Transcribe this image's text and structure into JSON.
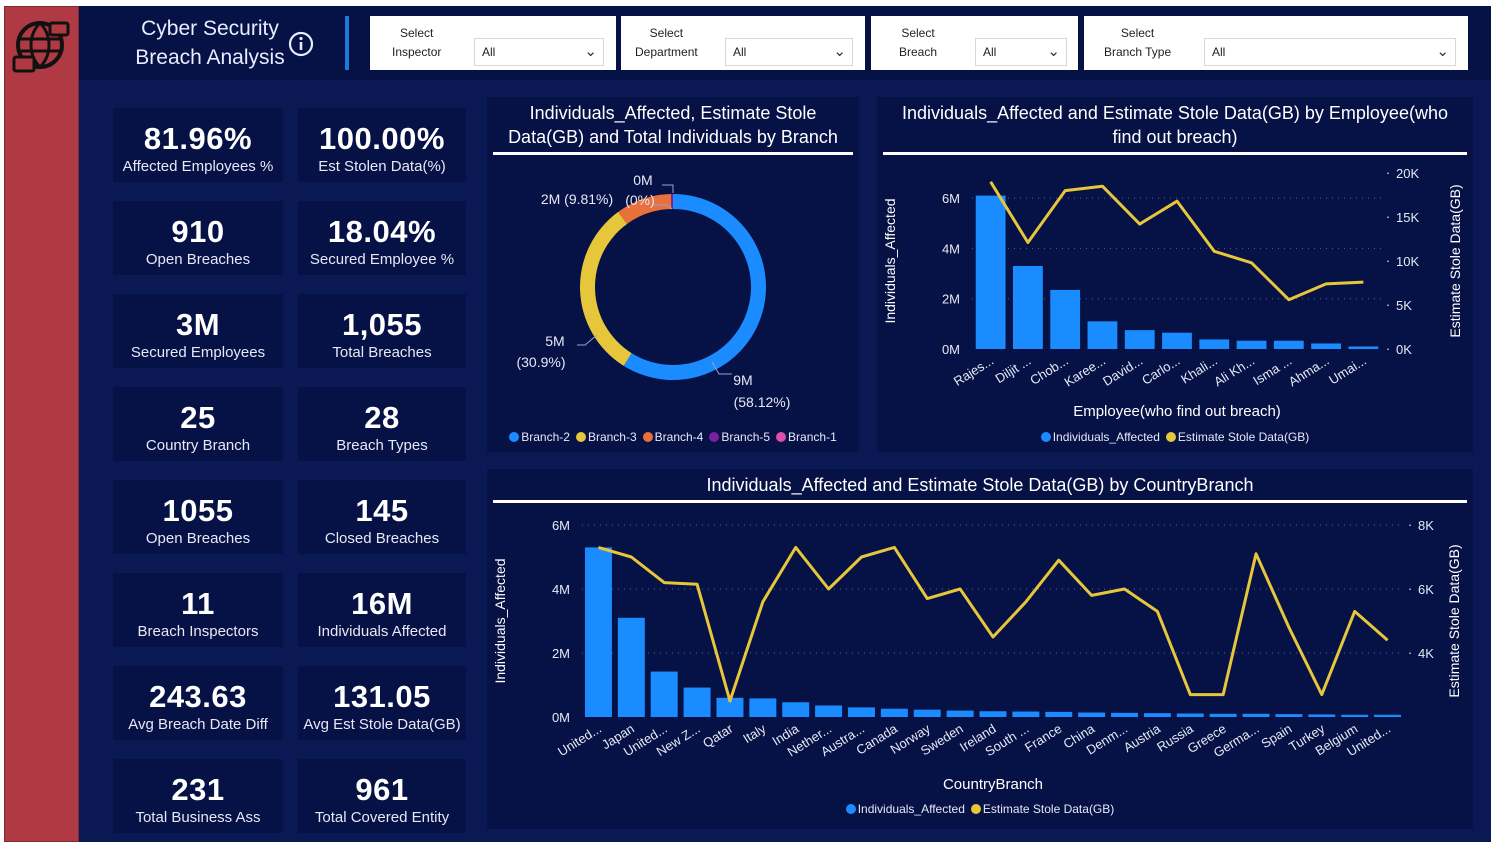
{
  "header": {
    "title_line1": "Cyber Security",
    "title_line2": "Breach Analysis",
    "filters": [
      {
        "label1": "Select",
        "label2": "Inspector",
        "value": "All"
      },
      {
        "label1": "Select",
        "label2": "Department",
        "value": "All"
      },
      {
        "label1": "Select",
        "label2": "Breach",
        "value": "All"
      },
      {
        "label1": "Select",
        "label2": "Branch Type",
        "value": "All"
      }
    ]
  },
  "kpis": [
    {
      "value": "81.96%",
      "label": "Affected Employees %"
    },
    {
      "value": "100.00%",
      "label": "Est Stolen Data(%)"
    },
    {
      "value": "910",
      "label": "Open Breaches"
    },
    {
      "value": "18.04%",
      "label": "Secured Employee %"
    },
    {
      "value": "3M",
      "label": "Secured Employees"
    },
    {
      "value": "1,055",
      "label": "Total Breaches"
    },
    {
      "value": "25",
      "label": "Country Branch"
    },
    {
      "value": "28",
      "label": "Breach Types"
    },
    {
      "value": "1055",
      "label": "Open Breaches"
    },
    {
      "value": "145",
      "label": "Closed Breaches"
    },
    {
      "value": "11",
      "label": "Breach Inspectors"
    },
    {
      "value": "16M",
      "label": "Individuals Affected"
    },
    {
      "value": "243.63",
      "label": "Avg Breach Date Diff"
    },
    {
      "value": "131.05",
      "label": "Avg Est Stole Data(GB)"
    },
    {
      "value": "231",
      "label": "Total Business Ass"
    },
    {
      "value": "961",
      "label": "Total Covered Entity"
    }
  ],
  "colors": {
    "sidebar": "#b03a43",
    "background": "#0a1854",
    "panel": "#061145",
    "bar": "#1a8cff",
    "line": "#e6c63a",
    "branch2": "#1a8cff",
    "branch3": "#e6c63a",
    "branch4": "#e8703a",
    "branch5": "#7a1fa0",
    "branch1": "#e04fa8"
  },
  "icons": {
    "logo": "globe-network-icon",
    "info": "info-icon",
    "dropdown": "chevron-down-icon"
  },
  "chart_data": [
    {
      "type": "pie",
      "donut": true,
      "title": "Individuals_Affected, Estimate Stole Data(GB) and Total Individuals by Branch",
      "categories": [
        "Branch-2",
        "Branch-3",
        "Branch-4",
        "Branch-5",
        "Branch-1"
      ],
      "values": [
        9.1,
        4.8,
        1.5,
        0.05,
        0.0
      ],
      "data_labels": [
        "9M\n(58.12%)",
        "5M\n(30.9%)",
        "2M (9.81%)",
        "0M\n(0%)",
        ""
      ],
      "legend": "bottom"
    },
    {
      "type": "bar",
      "combo_line": true,
      "title": "Individuals_Affected and Estimate Stole Data(GB) by Employee(who find out breach)",
      "xlabel": "Employee(who find out breach)",
      "ylabel": "Individuals_Affected",
      "y2label": "Estimate Stole Data(GB)",
      "categories": [
        "Rajes...",
        "Diljit ...",
        "Chob...",
        "Karee...",
        "David...",
        "Carlo...",
        "Khali...",
        "Ali Kh...",
        "Isma ...",
        "Ahma...",
        "Umai..."
      ],
      "yticks": [
        "0M",
        "2M",
        "4M",
        "6M"
      ],
      "y2ticks": [
        "0K",
        "5K",
        "10K",
        "15K",
        "20K"
      ],
      "ylim": [
        0,
        7
      ],
      "y2lim": [
        0,
        20000
      ],
      "series": [
        {
          "name": "Individuals_Affected",
          "axis": "left",
          "values": [
            6.1,
            3.3,
            2.35,
            1.1,
            0.75,
            0.65,
            0.38,
            0.33,
            0.33,
            0.22,
            0.1
          ]
        },
        {
          "name": "Estimate Stole Data(GB)",
          "axis": "right",
          "values": [
            19000,
            12100,
            18000,
            18500,
            14200,
            16800,
            11100,
            9800,
            5600,
            7400,
            7600
          ]
        }
      ],
      "legend": "bottom"
    },
    {
      "type": "bar",
      "combo_line": true,
      "title": "Individuals_Affected and Estimate Stole Data(GB) by CountryBranch",
      "xlabel": "CountryBranch",
      "ylabel": "Individuals_Affected",
      "y2label": "Estimate Stole Data(GB)",
      "categories": [
        "United...",
        "Japan",
        "United...",
        "New Z...",
        "Qatar",
        "Italy",
        "India",
        "Nether...",
        "Austra...",
        "Canada",
        "Norway",
        "Sweden",
        "Ireland",
        "South ...",
        "France",
        "China",
        "Denm...",
        "Austria",
        "Russia",
        "Greece",
        "Germa...",
        "Spain",
        "Turkey",
        "Belgium",
        "United..."
      ],
      "yticks": [
        "0M",
        "2M",
        "4M",
        "6M"
      ],
      "y2ticks": [
        "4K",
        "6K",
        "8K"
      ],
      "ylim": [
        0,
        6
      ],
      "y2lim": [
        2000,
        8000
      ],
      "series": [
        {
          "name": "Individuals_Affected",
          "axis": "left",
          "values": [
            5.3,
            3.1,
            1.42,
            0.92,
            0.6,
            0.58,
            0.46,
            0.36,
            0.3,
            0.26,
            0.23,
            0.2,
            0.18,
            0.17,
            0.16,
            0.14,
            0.13,
            0.12,
            0.11,
            0.1,
            0.1,
            0.09,
            0.08,
            0.07,
            0.07
          ]
        },
        {
          "name": "Estimate Stole Data(GB)",
          "axis": "right",
          "values": [
            7300,
            7000,
            6200,
            6150,
            2500,
            5600,
            7300,
            6000,
            7000,
            7300,
            5700,
            6000,
            4500,
            5600,
            6900,
            5800,
            6000,
            5300,
            2700,
            2700,
            7100,
            4800,
            2700,
            5300,
            4400
          ]
        }
      ],
      "legend": "bottom"
    }
  ]
}
